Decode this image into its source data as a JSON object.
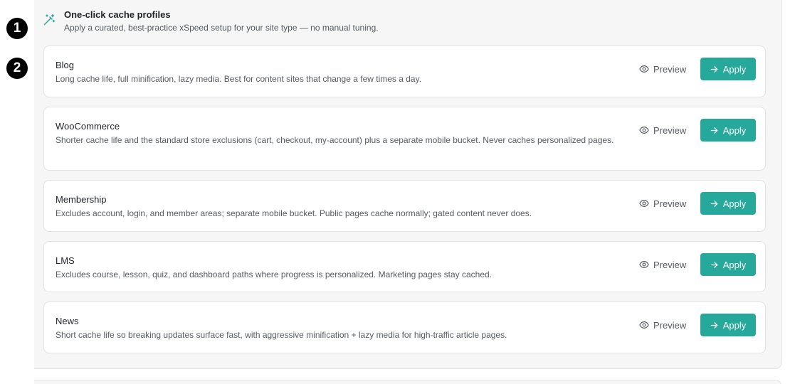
{
  "steps": [
    "1",
    "2"
  ],
  "header": {
    "icon": "magic-wand-icon",
    "title": "One-click cache profiles",
    "subtitle": "Apply a curated, best-practice xSpeed setup for your site type — no manual tuning."
  },
  "actions": {
    "preview_label": "Preview",
    "apply_label": "Apply",
    "preview_icon": "eye-icon",
    "apply_icon": "arrow-right-icon"
  },
  "colors": {
    "accent": "#26a89a",
    "panel_bg": "#f6f6f6",
    "card_border": "#e2e2e2"
  },
  "profiles": [
    {
      "name": "Blog",
      "description": "Long cache life, full minification, lazy media. Best for content sites that change a few times a day."
    },
    {
      "name": "WooCommerce",
      "description": "Shorter cache life and the standard store exclusions (cart, checkout, my-account) plus a separate mobile bucket. Never caches personalized pages."
    },
    {
      "name": "Membership",
      "description": "Excludes account, login, and member areas; separate mobile bucket. Public pages cache normally; gated content never does."
    },
    {
      "name": "LMS",
      "description": "Excludes course, lesson, quiz, and dashboard paths where progress is personalized. Marketing pages stay cached."
    },
    {
      "name": "News",
      "description": "Short cache life so breaking updates surface fast, with aggressive minification + lazy media for high-traffic article pages."
    }
  ]
}
